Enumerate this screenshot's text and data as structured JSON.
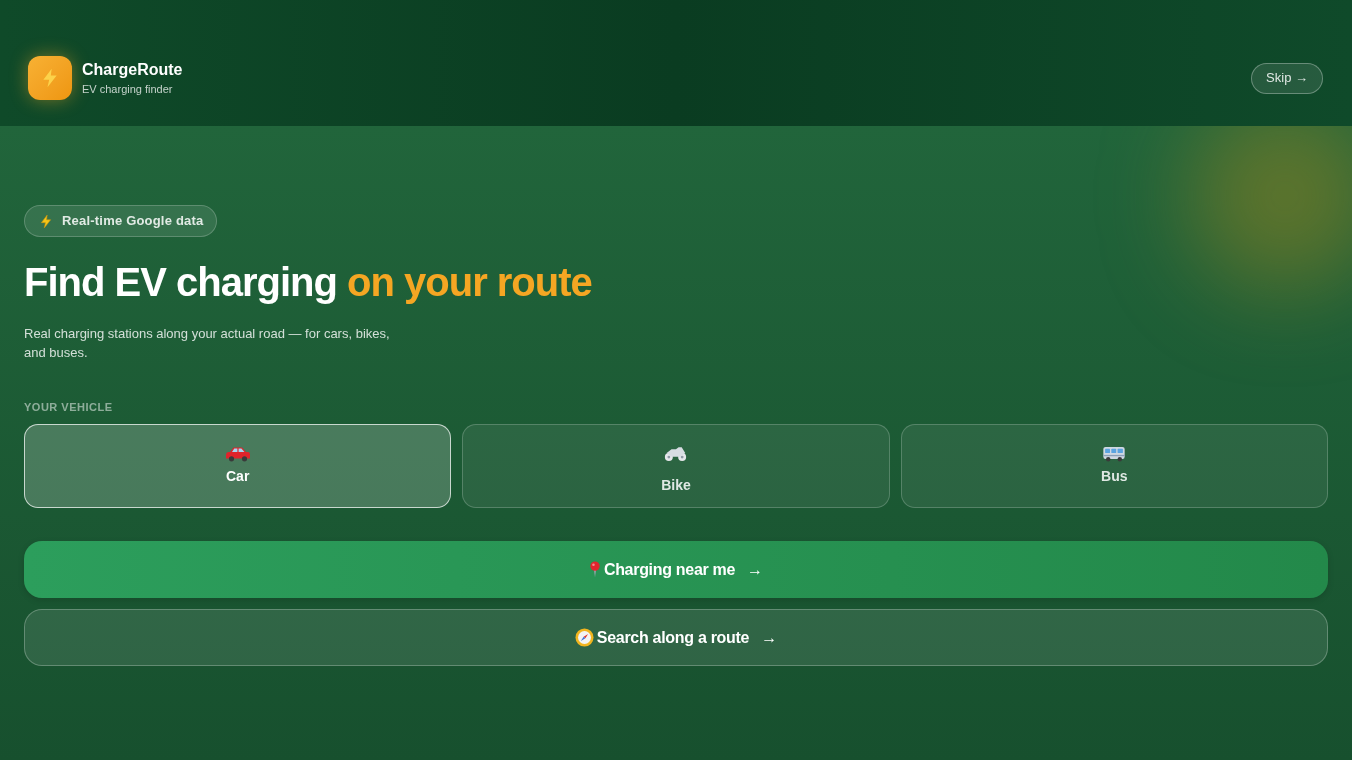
{
  "header": {
    "app_name": "ChargeRoute",
    "tagline": "EV charging finder",
    "skip_button": "Skip →"
  },
  "badge": "Real-time Google data",
  "headline": {
    "text": "Find EV charging",
    "highlight": "on your route"
  },
  "description": "Real charging stations along your actual road — for cars, bikes, and buses.",
  "vehicle_section": {
    "label": "YOUR VEHICLE",
    "options": [
      {
        "kind": "car",
        "label": "Car",
        "selected": true
      },
      {
        "kind": "bike",
        "label": "Bike",
        "selected": false
      },
      {
        "kind": "bus",
        "label": "Bus",
        "selected": false
      }
    ]
  },
  "actions": [
    {
      "kind": "primary",
      "label": "Charging near me",
      "arrow": "→"
    },
    {
      "kind": "secondary",
      "label": "Search along a route",
      "arrow": "→"
    }
  ]
}
